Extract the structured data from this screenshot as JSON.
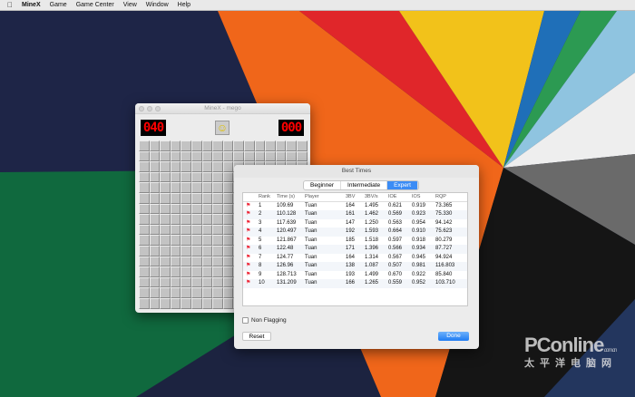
{
  "menubar": {
    "items": [
      "MineX",
      "Game",
      "Game Center",
      "View",
      "Window",
      "Help"
    ]
  },
  "game_window": {
    "title": "MineX - mego",
    "mines_counter": "040",
    "timer": "000",
    "face": "☺",
    "rows": 16,
    "cols": 16
  },
  "dialog": {
    "title": "Best Times",
    "tabs": [
      "Beginner",
      "Intermediate",
      "Expert"
    ],
    "selected_tab": "Expert",
    "columns": [
      "Rank",
      "Time (s)",
      "Player",
      "3BV",
      "3BV/s",
      "IOE",
      "IOS",
      "RQP"
    ],
    "rows": [
      [
        "1",
        "109.69",
        "Tuan",
        "164",
        "1.495",
        "0.621",
        "0.919",
        "73.365"
      ],
      [
        "2",
        "110.128",
        "Tuan",
        "161",
        "1.462",
        "0.569",
        "0.923",
        "75.330"
      ],
      [
        "3",
        "117.639",
        "Tuan",
        "147",
        "1.250",
        "0.563",
        "0.954",
        "94.142"
      ],
      [
        "4",
        "120.497",
        "Tuan",
        "192",
        "1.593",
        "0.664",
        "0.910",
        "75.623"
      ],
      [
        "5",
        "121.867",
        "Tuan",
        "185",
        "1.518",
        "0.597",
        "0.918",
        "80.279"
      ],
      [
        "6",
        "122.48",
        "Tuan",
        "171",
        "1.396",
        "0.566",
        "0.934",
        "87.727"
      ],
      [
        "7",
        "124.77",
        "Tuan",
        "164",
        "1.314",
        "0.567",
        "0.945",
        "94.924"
      ],
      [
        "8",
        "126.96",
        "Tuan",
        "138",
        "1.087",
        "0.507",
        "0.981",
        "116.803"
      ],
      [
        "9",
        "128.713",
        "Tuan",
        "193",
        "1.499",
        "0.670",
        "0.922",
        "85.840"
      ],
      [
        "10",
        "131.209",
        "Tuan",
        "166",
        "1.265",
        "0.559",
        "0.952",
        "103.710"
      ]
    ],
    "non_flagging_label": "Non Flagging",
    "reset_label": "Reset",
    "done_label": "Done"
  },
  "watermark": {
    "brand": "PConline",
    "domain": ".com.cn",
    "cn": "太平洋电脑网"
  }
}
